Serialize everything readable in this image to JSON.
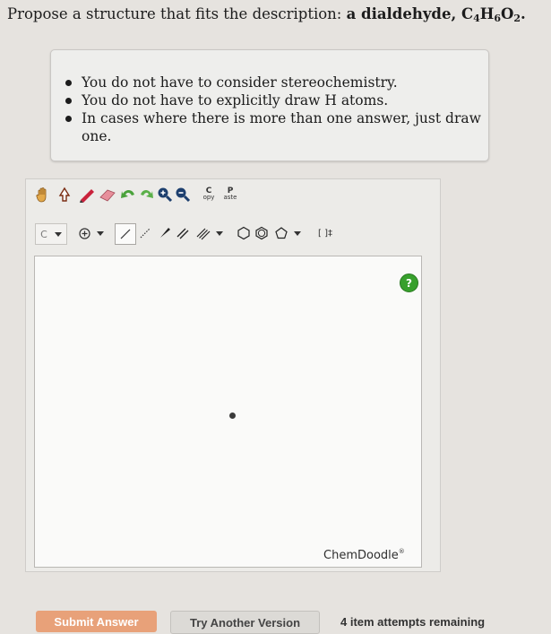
{
  "question": {
    "prefix": "Propose a structure that fits the description: ",
    "bold_text": "a dialdehyde, C",
    "formula_parts": [
      "4",
      "H",
      "6",
      "O",
      "2"
    ],
    "suffix": "."
  },
  "instructions": [
    "You do not have to consider stereochemistry.",
    "You do not have to explicitly draw H atoms.",
    "In cases where there is more than one answer, just draw one."
  ],
  "toolbar": {
    "copy_label_top": "C",
    "copy_label_bottom": "opy",
    "paste_label_top": "P",
    "paste_label_bottom": "aste",
    "element_label": "C",
    "bracket_label": "[ ]‡"
  },
  "canvas": {
    "help_label": "?",
    "watermark": "ChemDoodle",
    "watermark_mark": "®"
  },
  "buttons": {
    "submit": "Submit Answer",
    "try_another": "Try Another Version"
  },
  "attempts_text": "4 item attempts remaining",
  "colors": {
    "submit_bg": "#e8a179",
    "help_bg": "#37a02c",
    "pencil": "#c9223b"
  }
}
